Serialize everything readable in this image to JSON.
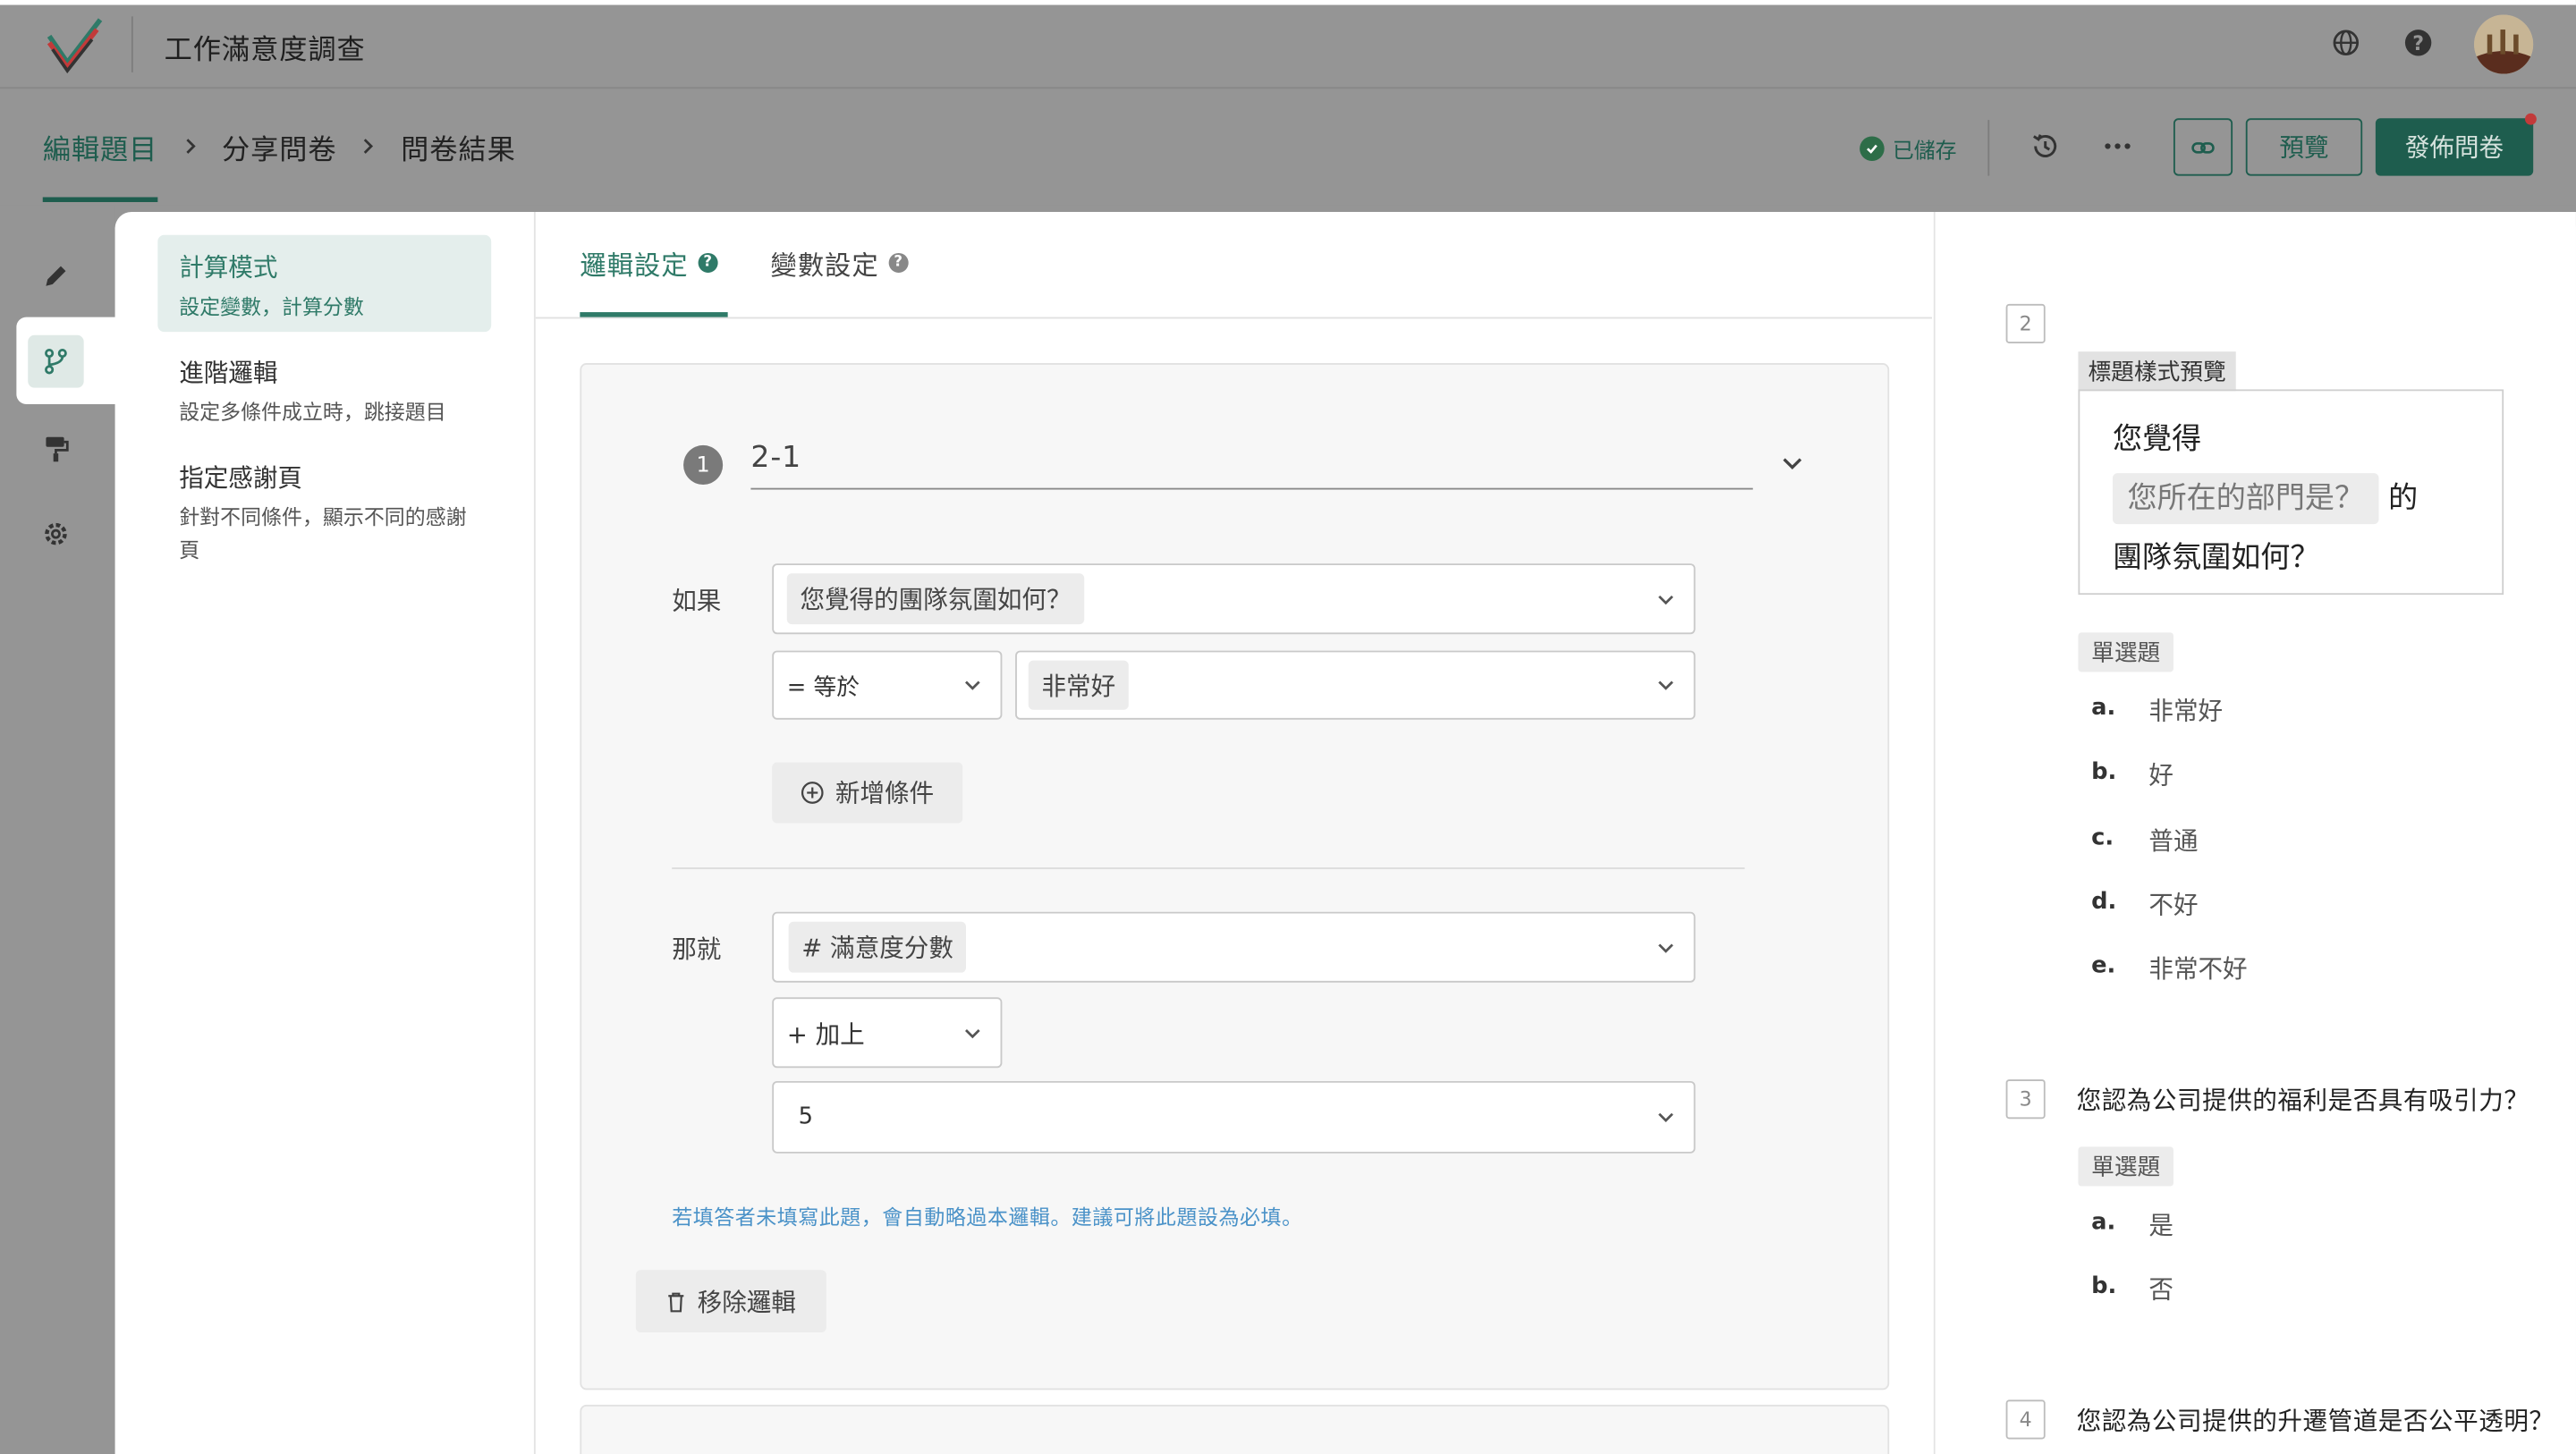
{
  "app": {
    "title": "工作滿意度調查"
  },
  "steps": {
    "edit": "編輯題目",
    "share": "分享問卷",
    "results": "問卷結果"
  },
  "status": {
    "saved": "已儲存"
  },
  "toolbar": {
    "preview": "預覽",
    "publish": "發佈問卷"
  },
  "logic_nav": {
    "calc": {
      "title": "計算模式",
      "desc": "設定變數，計算分數"
    },
    "advanced": {
      "title": "進階邏輯",
      "desc": "設定多條件成立時，跳接題目"
    },
    "thanks": {
      "title": "指定感謝頁",
      "desc": "針對不同條件，顯示不同的感謝頁"
    }
  },
  "tabs": {
    "logic": "邏輯設定",
    "variables": "變數設定"
  },
  "rule": {
    "number": "1",
    "name": "2-1",
    "if_label": "如果",
    "then_label": "那就",
    "question": "您覺得的團隊氛圍如何？",
    "operator": "= 等於",
    "value": "非常好",
    "add_condition": "新增條件",
    "variable": "# 滿意度分數",
    "action": "+ 加上",
    "amount": "5",
    "hint": "若填答者未填寫此題，會自動略過本邏輯。建議可將此題設為必填。",
    "remove": "移除邏輯"
  },
  "preview": {
    "q2": {
      "number": "2",
      "style_label": "標題樣式預覽",
      "title_pre": "您覺得",
      "title_var": "您所在的部門是？",
      "title_mid": "的",
      "title_post": "團隊氛圍如何？",
      "type": "單選題",
      "options": [
        {
          "letter": "a.",
          "text": "非常好"
        },
        {
          "letter": "b.",
          "text": "好"
        },
        {
          "letter": "c.",
          "text": "普通"
        },
        {
          "letter": "d.",
          "text": "不好"
        },
        {
          "letter": "e.",
          "text": "非常不好"
        }
      ]
    },
    "q3": {
      "number": "3",
      "title": "您認為公司提供的福利是否具有吸引力？",
      "type": "單選題",
      "options": [
        {
          "letter": "a.",
          "text": "是"
        },
        {
          "letter": "b.",
          "text": "否"
        }
      ]
    },
    "q4": {
      "number": "4",
      "title": "您認為公司提供的升遷管道是否公平透明？"
    }
  },
  "colors": {
    "brand": "#1e5d4e",
    "accent": "#2f7a68",
    "hint": "#4a92c8"
  }
}
